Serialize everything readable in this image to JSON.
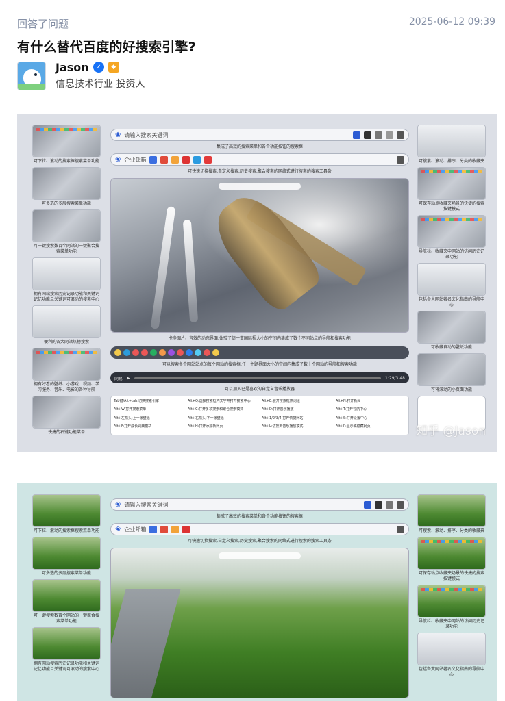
{
  "activity": {
    "label": "回答了问题",
    "time": "2025-06-12 09:39"
  },
  "question": {
    "title": "有什么替代百度的好搜索引擎?"
  },
  "author": {
    "name": "Jason",
    "verified_icon": "check-circle-icon",
    "badge_icon": "medal-icon",
    "bio": "信息技术行业 投资人"
  },
  "image1": {
    "search_placeholder": "请输入搜索关键词",
    "search_note": "集成了高效的搜索菜单和各个功能按钮的搜索框",
    "second_bar_placeholder": "企业邮箱",
    "second_note": "可快速切换搜索,自定义搜索,历史搜索,聚合搜索的网络式进行搜索的搜索工具条",
    "hero_note": "卡多图片、音效的动态界面,体验了仿一支国际视大小的空间内集成了数个不同站点的导航和搜索功能",
    "dock_note": "可以搜索各个网站站点的每个网站的搜索框,任一主题界面大小的空间内集成了数十个网站的导航和搜索功能",
    "player_note": "可以加入已是喜欢的自定义音乐播放器",
    "player_label": "网易",
    "player_time": "1:29/3:48",
    "shortcuts": [
      "Tab键/Alt+tab:切换搜索引擎",
      "Alt+Q:选择搜索框内文字并打开搜索中心",
      "Alt+E:展开搜索框热词组",
      "Alt+N:打开新闻",
      "Alt+W:打开搜索菜单",
      "Alt+C:打开多项搜索和聚合搜索模式",
      "Alt+D:打开音乐播放",
      "Alt+T:打开导航中心",
      "Alt+左箭头:上一张壁纸",
      "Alt+右箭头:下一张壁纸",
      "Alt+1/2/3/4:打开快捷网站",
      "Alt+S:打开设置中心",
      "Alt+F:打开成长词典模块",
      "Alt+H:打开添加新网页",
      "Alt+L:切换到音乐播放模式",
      "Alt+P:显示或隐藏网页"
    ],
    "left_captions": [
      "可下拉、滚动的搜索框搜索菜单功能",
      "可多选的多层搜索菜单功能",
      "可一键搜索数百个网站的一键聚合搜索菜单功能",
      "拥有网站搜索历史记录功能和关键词记忆功能且关键词可滚动的搜索中心",
      "便利的各大网站热榜搜索",
      "拥有好看的壁纸、小游戏、视频、学习服务、音乐、电影的各种导航",
      "快捷的右键功能菜单"
    ],
    "right_captions": [
      "可搜索、滚动、排序、分类的收藏夹",
      "可保存站点收藏夹场景的快捷的搜索按键模式",
      "导航栏、收藏夹中网站的访问历史记录功能",
      "包括各大网站著名文化指南的导航中心",
      "可收藏自动的壁纸功能",
      "可将滚动的小页面功能"
    ],
    "watermark": "知乎 @Jason"
  },
  "image2": {
    "search_placeholder": "请输入搜索关键词",
    "search_note": "集成了高效的搜索菜单和各个功能按钮的搜索框",
    "second_bar_placeholder": "企业邮箱",
    "second_note": "可快速切换搜索,自定义搜索,历史搜索,聚合搜索的网络式进行搜索的搜索工具条",
    "left_captions": [
      "可下拉、滚动的搜索框搜索菜单功能",
      "可多选的多层搜索菜单功能",
      "可一键搜索数百个网站的一键聚合搜索菜单功能",
      "拥有网站搜索历史记录功能和关键词记忆功能且关键词可滚动的搜索中心"
    ],
    "right_captions": [
      "可搜索、滚动、排序、分类的收藏夹",
      "可保存站点收藏夹场景的快捷的搜索按键模式",
      "导航栏、收藏夹中网站的访问历史记录功能",
      "包括各大网站著名文化指南的导航中心"
    ]
  },
  "colors": {
    "meta_gray": "#8590a6",
    "verified_blue": "#1772f6",
    "badge_orange": "#f5a623"
  }
}
